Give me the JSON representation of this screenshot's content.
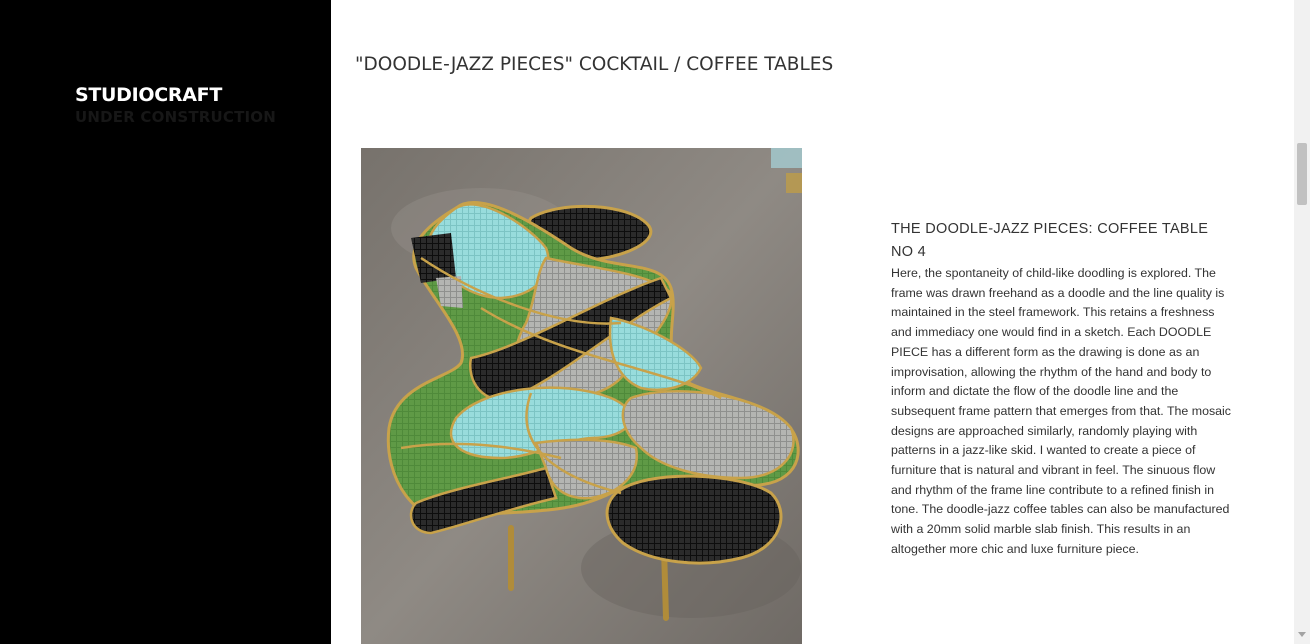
{
  "sidebar": {
    "brand": "STUDIOCRAFT",
    "tagline": "UNDER CONSTRUCTION"
  },
  "main": {
    "page_title": "\"DOODLE-JAZZ PIECES\" COCKTAIL / COFFEE TABLES",
    "product": {
      "image_alt": "mosaic coffee table photo",
      "title": "THE DOODLE-JAZZ PIECES: COFFEE TABLE NO 4",
      "description": "Here, the spontaneity of child-like doodling is explored. The frame was drawn freehand as a doodle and the line quality is maintained in the steel framework. This retains a freshness and immediacy one would find in a sketch. Each DOODLE PIECE has a different form as the drawing is done as an improvisation, allowing the rhythm of the hand and body to inform and dictate the flow of the doodle line and the subsequent frame pattern that emerges from that. The mosaic designs are approached similarly, randomly playing with patterns in a jazz-like skid. I wanted to create a piece of furniture that is natural and vibrant in feel. The sinuous flow and rhythm of the frame line contribute to a refined finish in tone. The doodle-jazz coffee tables can also be manufactured with a 20mm solid marble slab finish. This results in an altogether more chic and luxe furniture piece."
    }
  },
  "colors": {
    "sidebar_bg": "#000000",
    "brand_text": "#ffffff",
    "tagline_text": "#171717",
    "body_text": "#333333",
    "mosaic_green": "#4f8a3a",
    "mosaic_aqua": "#8fd3d3",
    "mosaic_black": "#1c1c1c",
    "mosaic_grey": "#a9aaa8",
    "brass_frame": "#c8a24a"
  }
}
